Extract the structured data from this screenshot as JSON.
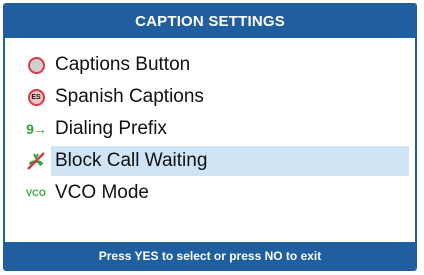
{
  "header": {
    "title": "CAPTION SETTINGS"
  },
  "menu": {
    "items": [
      {
        "label": "Captions Button",
        "icon": "captions-button-icon"
      },
      {
        "label": "Spanish Captions",
        "icon": "spanish-captions-icon",
        "icon_text": "ES"
      },
      {
        "label": "Dialing Prefix",
        "icon": "dialing-prefix-icon",
        "icon_text": "9→"
      },
      {
        "label": "Block Call Waiting",
        "icon": "block-call-waiting-icon",
        "selected": true
      },
      {
        "label": "VCO Mode",
        "icon": "vco-icon",
        "icon_text": "VCO"
      }
    ]
  },
  "footer": {
    "hint": "Press YES to select or press NO to exit"
  },
  "colors": {
    "accent": "#1f5f9f",
    "highlight": "#cfe5f5",
    "icon_green": "#2fa532",
    "icon_red": "#d83a4a"
  }
}
